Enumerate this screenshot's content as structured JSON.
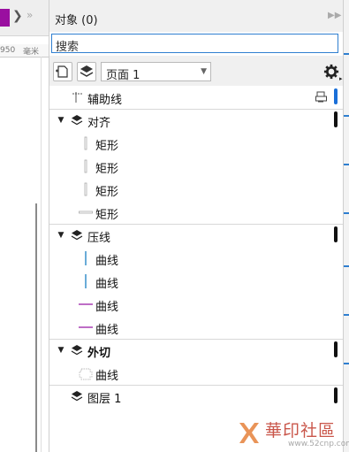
{
  "left_canvas": {
    "ruler_number": "950",
    "ruler_unit": "毫米",
    "accent_color": "#9a0fa0"
  },
  "panel": {
    "title": "对象 (0)",
    "search_placeholder": "搜索",
    "page_selector": {
      "value": "页面 1"
    }
  },
  "tree": {
    "guides": {
      "label": "辅助线"
    },
    "layers": [
      {
        "label": "对齐",
        "expanded": true,
        "bar_color": "#111111",
        "objects": [
          {
            "label": "矩形",
            "icon": "rect-vertical-icon"
          },
          {
            "label": "矩形",
            "icon": "rect-vertical-icon"
          },
          {
            "label": "矩形",
            "icon": "rect-vertical-icon"
          },
          {
            "label": "矩形",
            "icon": "rect-horizontal-icon"
          }
        ]
      },
      {
        "label": "压线",
        "expanded": true,
        "bar_color": "#111111",
        "objects": [
          {
            "label": "曲线",
            "icon": "curve-blue-vertical-icon",
            "color": "#1a7fc4"
          },
          {
            "label": "曲线",
            "icon": "curve-blue-vertical-icon",
            "color": "#1a7fc4"
          },
          {
            "label": "曲线",
            "icon": "curve-purple-horizontal-icon",
            "color": "#9a1fa8"
          },
          {
            "label": "曲线",
            "icon": "curve-purple-horizontal-icon",
            "color": "#9a1fa8"
          }
        ]
      },
      {
        "label": "外切",
        "expanded": true,
        "bold": true,
        "bar_color": "#111111",
        "objects": [
          {
            "label": "曲线",
            "icon": "curve-dashed-shape-icon"
          }
        ]
      },
      {
        "label": "图层 1",
        "expanded": false,
        "bar_color": "#111111",
        "objects": []
      }
    ]
  },
  "watermark": {
    "text": "華印社區",
    "url": "www.52cnp.com"
  }
}
